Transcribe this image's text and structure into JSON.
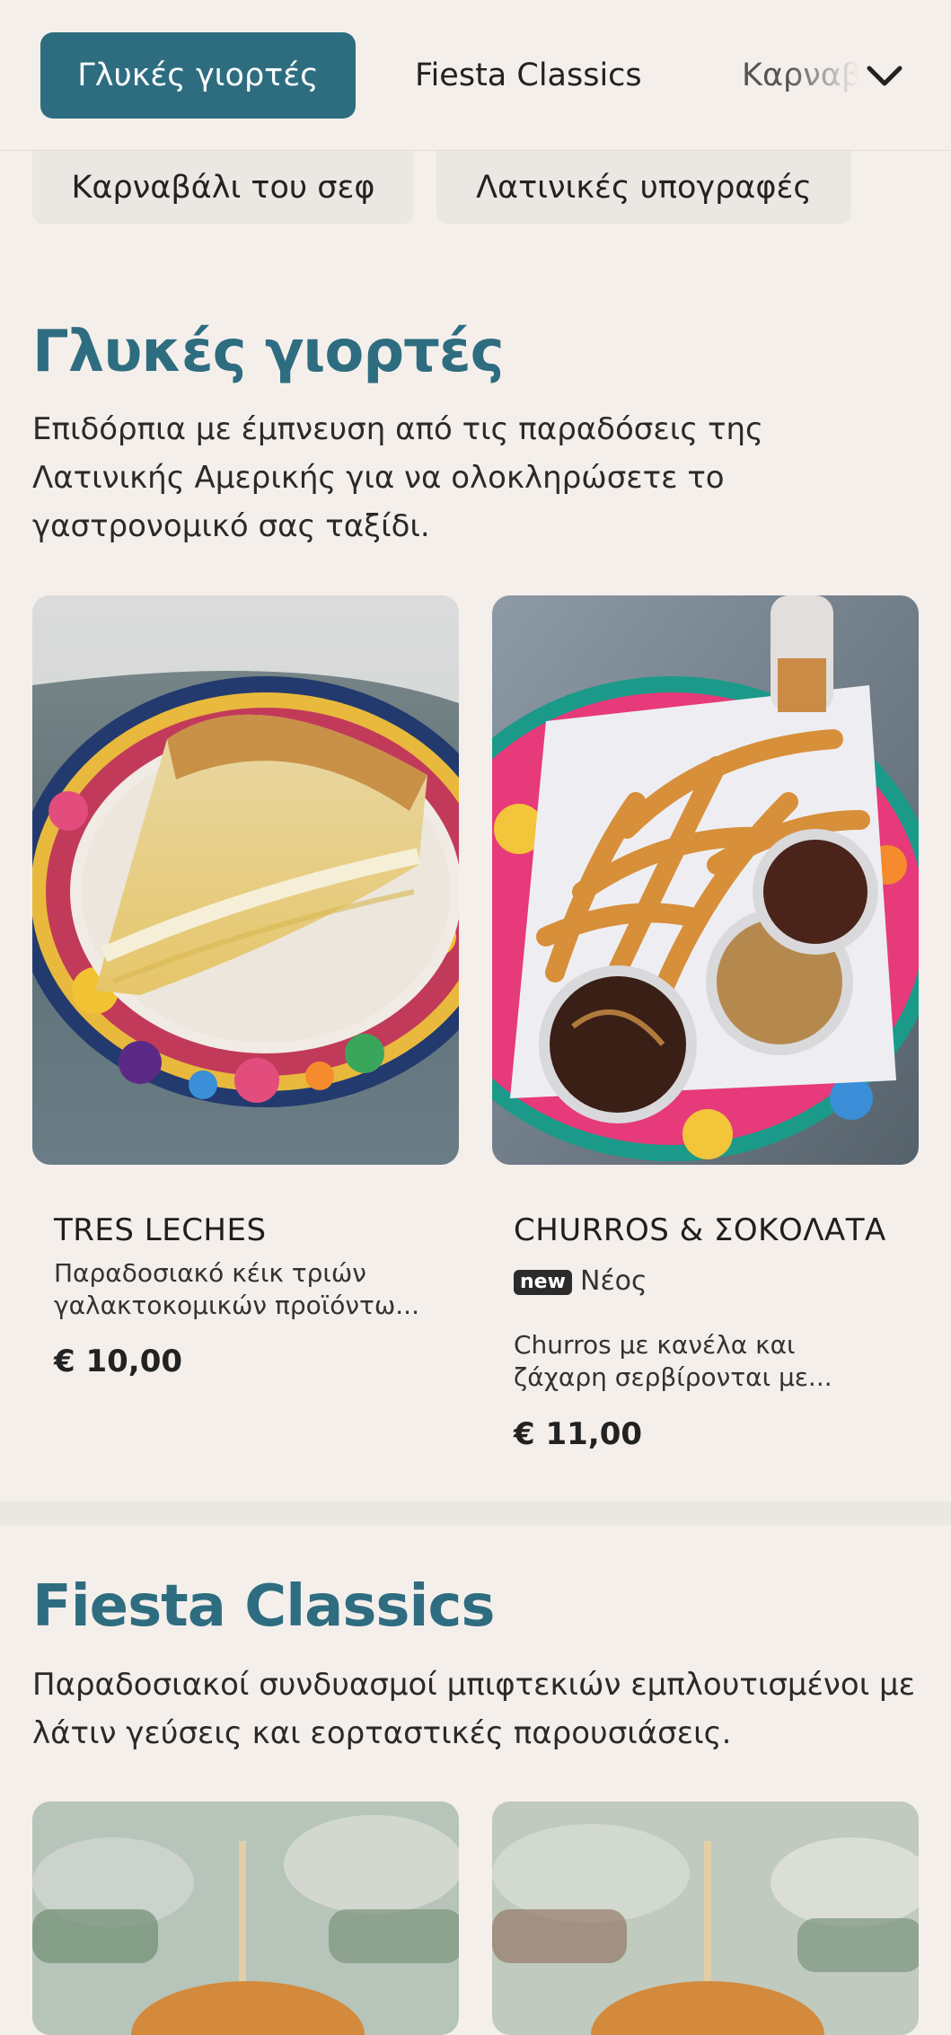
{
  "tabs": [
    {
      "label": "Γλυκές γιορτές",
      "active": true
    },
    {
      "label": "Fiesta Classics",
      "active": false
    },
    {
      "label": "Καρναβάλι του σεφ",
      "active": false
    }
  ],
  "chips": [
    {
      "label": "Καρναβάλι του σεφ"
    },
    {
      "label": "Λατινικές υπογραφές"
    }
  ],
  "sections": [
    {
      "title": "Γλυκές γιορτές",
      "description": "Επιδόρπια με έμπνευση από τις παραδόσεις της Λατινικής Αμερικής για να ολοκληρώσετε το γαστρονομικό σας ταξίδι.",
      "items": [
        {
          "name": "TRES LECHES",
          "description": "Παραδοσιακό κέικ τριών γαλακτοκομικών προϊόντω...",
          "price": "€ 10,00"
        },
        {
          "name": "CHURROS & ΣΟΚΟΛΑΤΑ",
          "badge": "new",
          "badge_label": "Νέος",
          "description": "Churros με κανέλα και ζάχαρη σερβίρονται με...",
          "price": "€ 11,00"
        }
      ]
    },
    {
      "title": "Fiesta Classics",
      "description": "Παραδοσιακοί συνδυασμοί μπιφτεκιών εμπλουτισμένοι με λάτιν γεύσεις και εορταστικές παρουσιάσεις."
    }
  ],
  "colors": {
    "accent": "#2e6d80",
    "background": "#f5efeb",
    "chip": "#ebe7e2"
  }
}
